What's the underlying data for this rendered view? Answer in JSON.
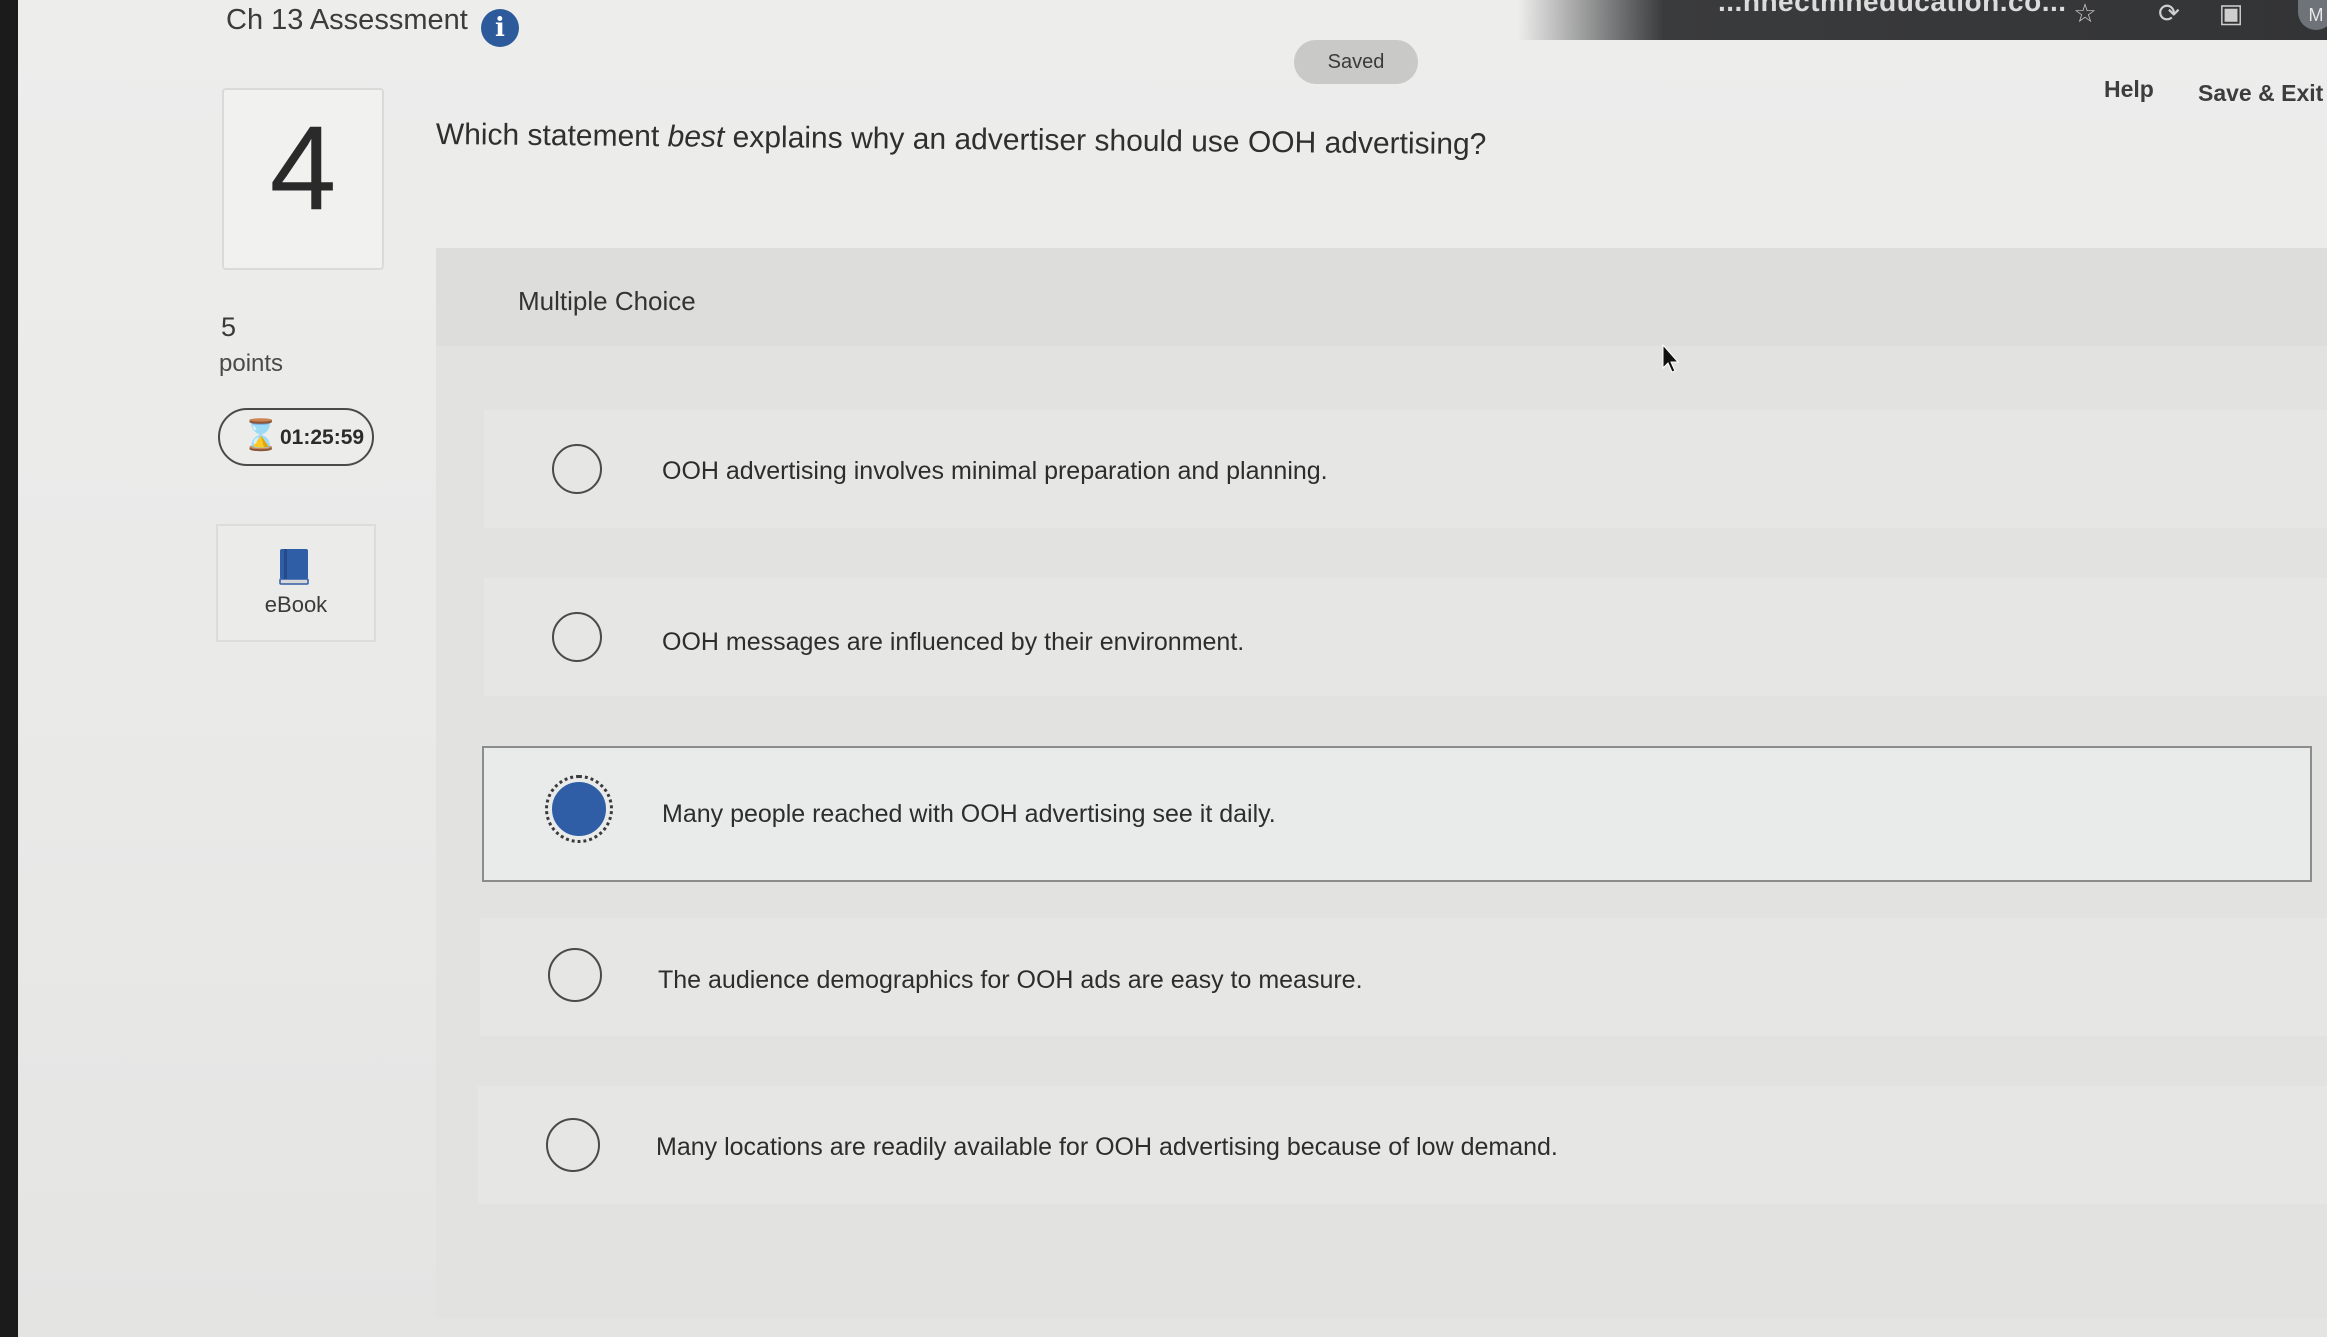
{
  "browser": {
    "url_fragment": "...nnectmheducation.co...",
    "profile_initial": "M"
  },
  "header": {
    "title": "Ch 13 Assessment",
    "info_glyph": "i",
    "saved_status": "Saved",
    "help_label": "Help",
    "save_exit_label": "Save & Exit"
  },
  "question": {
    "number": "4",
    "points_value": "5",
    "points_label": "points",
    "timer": "01:25:59",
    "ebook_label": "eBook",
    "text_before": "Which statement ",
    "text_emphasis": "best",
    "text_after": " explains why an advertiser should use OOH advertising?",
    "type_label": "Multiple Choice"
  },
  "options": [
    {
      "label": "OOH advertising involves minimal preparation and planning.",
      "selected": false
    },
    {
      "label": "OOH messages are influenced by their environment.",
      "selected": false
    },
    {
      "label": "Many people reached with OOH advertising see it daily.",
      "selected": true
    },
    {
      "label": "The audience demographics for OOH ads are easy to measure.",
      "selected": false
    },
    {
      "label": "Many locations are readily available for OOH advertising because of low demand.",
      "selected": false
    }
  ],
  "colors": {
    "accent": "#2f5ea6",
    "info_icon": "#2c5a9a"
  }
}
